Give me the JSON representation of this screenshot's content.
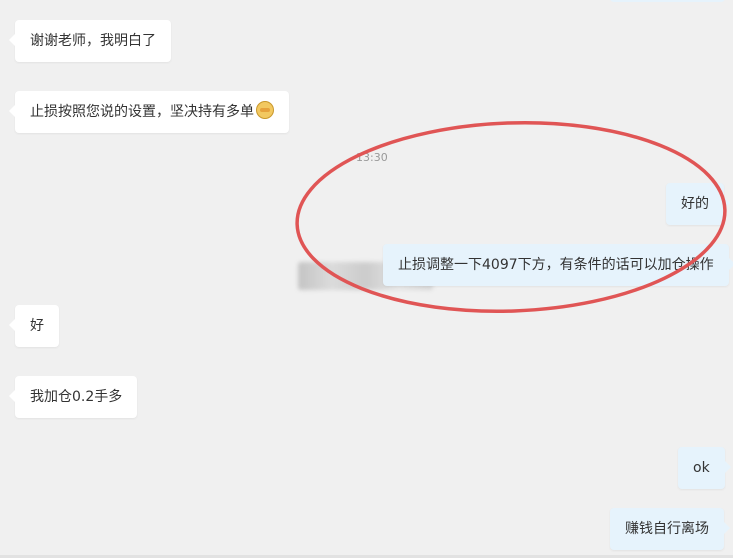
{
  "chat": {
    "timestamp": "13:30",
    "messages": [
      {
        "side": "in",
        "text": "谢谢老师，我明白了"
      },
      {
        "side": "in",
        "text": "止损按照您说的设置，坚决持有多单"
      },
      {
        "side": "out",
        "text": "好的"
      },
      {
        "side": "out",
        "text": "止损调整一下4097下方，有条件的话可以加仓操作"
      },
      {
        "side": "in",
        "text": "好"
      },
      {
        "side": "in",
        "text": "我加仓0.2手多"
      },
      {
        "side": "out",
        "text": "ok"
      },
      {
        "side": "out",
        "text": "赚钱自行离场"
      }
    ]
  },
  "icons": {
    "emoji": "fist-emoji-icon"
  },
  "colors": {
    "background": "#f0f0f0",
    "incoming_bubble": "#ffffff",
    "outgoing_bubble": "#e6f3fc",
    "annotation_ellipse": "#e05555"
  }
}
